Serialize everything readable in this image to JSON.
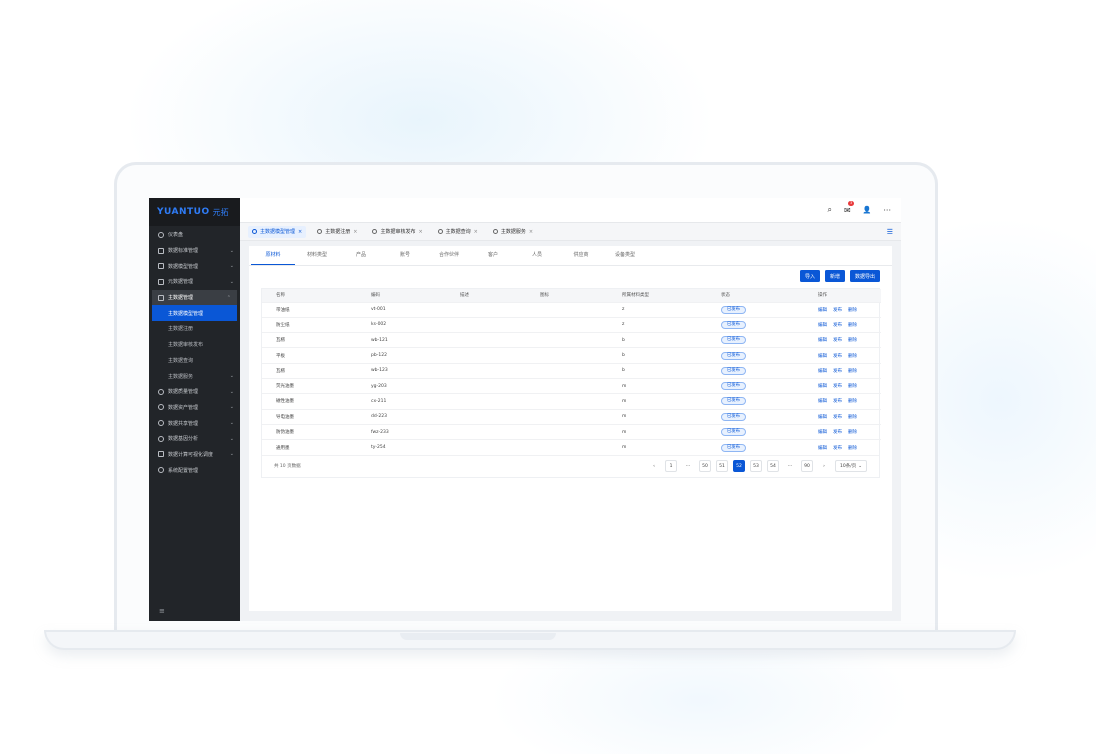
{
  "app": {
    "logo_en": "YUANTUO",
    "logo_cn": "元拓"
  },
  "sidebar": {
    "items": [
      {
        "label": "仪表盘",
        "icon": "gauge-icon",
        "chevron": ""
      },
      {
        "label": "数据标准管理",
        "icon": "grid-icon",
        "chevron": "⌄"
      },
      {
        "label": "数据模型管理",
        "icon": "model-icon",
        "chevron": "⌄"
      },
      {
        "label": "元数据管理",
        "icon": "cube-icon",
        "chevron": "⌄"
      },
      {
        "label": "主数据管理",
        "icon": "database-icon",
        "chevron": "⌃"
      }
    ],
    "sub_items": [
      {
        "label": "主数据模型管理",
        "chevron": ""
      },
      {
        "label": "主数据注册",
        "chevron": ""
      },
      {
        "label": "主数据审核发布",
        "chevron": ""
      },
      {
        "label": "主数据查询",
        "chevron": ""
      },
      {
        "label": "主数据服务",
        "chevron": "⌄"
      }
    ],
    "items_after": [
      {
        "label": "数据质量管理",
        "icon": "shield-icon",
        "chevron": "⌄"
      },
      {
        "label": "数据资产管理",
        "icon": "play-icon",
        "chevron": "⌄"
      },
      {
        "label": "数据共享管理",
        "icon": "share-icon",
        "chevron": "⌄"
      },
      {
        "label": "数据基因分析",
        "icon": "target-icon",
        "chevron": "⌄"
      },
      {
        "label": "数据计算可视化调度",
        "icon": "flow-icon",
        "chevron": "⌄"
      },
      {
        "label": "系统配置管理",
        "icon": "settings-icon",
        "chevron": ""
      }
    ],
    "collapse_icon": "≡"
  },
  "topbar": {
    "search_icon": "⌕",
    "mail_icon": "✉",
    "mail_badge": "3",
    "user_icon": "👤",
    "more_icon": "···"
  },
  "tabs": [
    {
      "label": "主数据模型管理",
      "close": "×"
    },
    {
      "label": "主数据注册",
      "close": "×"
    },
    {
      "label": "主数据审核发布",
      "close": "×"
    },
    {
      "label": "主数据查询",
      "close": "×"
    },
    {
      "label": "主数据服务",
      "close": "×"
    }
  ],
  "tab_menu_icon": "☰",
  "subtabs": [
    "原材料",
    "材料类型",
    "产品",
    "账号",
    "合作伙伴",
    "客户",
    "人员",
    "供应商",
    "设备类型"
  ],
  "buttons": {
    "import": "导入",
    "add": "新增",
    "export": "数据导出"
  },
  "table": {
    "headers": [
      "名称",
      "编码",
      "描述",
      "图标",
      "所属材料类型",
      "状态",
      "操作"
    ],
    "rows": [
      {
        "name": "带油纸",
        "code": "vt-001",
        "type": "z",
        "status": "已发布"
      },
      {
        "name": "防尘纸",
        "code": "ks-002",
        "type": "z",
        "status": "已发布"
      },
      {
        "name": "瓦楞",
        "code": "wb-121",
        "type": "b",
        "status": "已发布"
      },
      {
        "name": "平板",
        "code": "pb-122",
        "type": "b",
        "status": "已发布"
      },
      {
        "name": "瓦楞",
        "code": "wb-123",
        "type": "b",
        "status": "已发布"
      },
      {
        "name": "荧光油墨",
        "code": "yg-203",
        "type": "m",
        "status": "已发布"
      },
      {
        "name": "磁性油墨",
        "code": "cx-211",
        "type": "m",
        "status": "已发布"
      },
      {
        "name": "导电油墨",
        "code": "dd-223",
        "type": "m",
        "status": "已发布"
      },
      {
        "name": "防伪油墨",
        "code": "fwz-233",
        "type": "m",
        "status": "已发布"
      },
      {
        "name": "通用墨",
        "code": "ty-254",
        "type": "m",
        "status": "已发布"
      }
    ],
    "ops": [
      "编辑",
      "发布",
      "删除"
    ]
  },
  "pagination": {
    "total": "共 10 页数据",
    "prev": "‹",
    "next": "›",
    "pages": [
      "1",
      "···",
      "50",
      "51",
      "52",
      "53",
      "54",
      "···",
      "90"
    ],
    "active": "52",
    "page_size": "10条/页",
    "page_size_chevron": "⌄"
  }
}
